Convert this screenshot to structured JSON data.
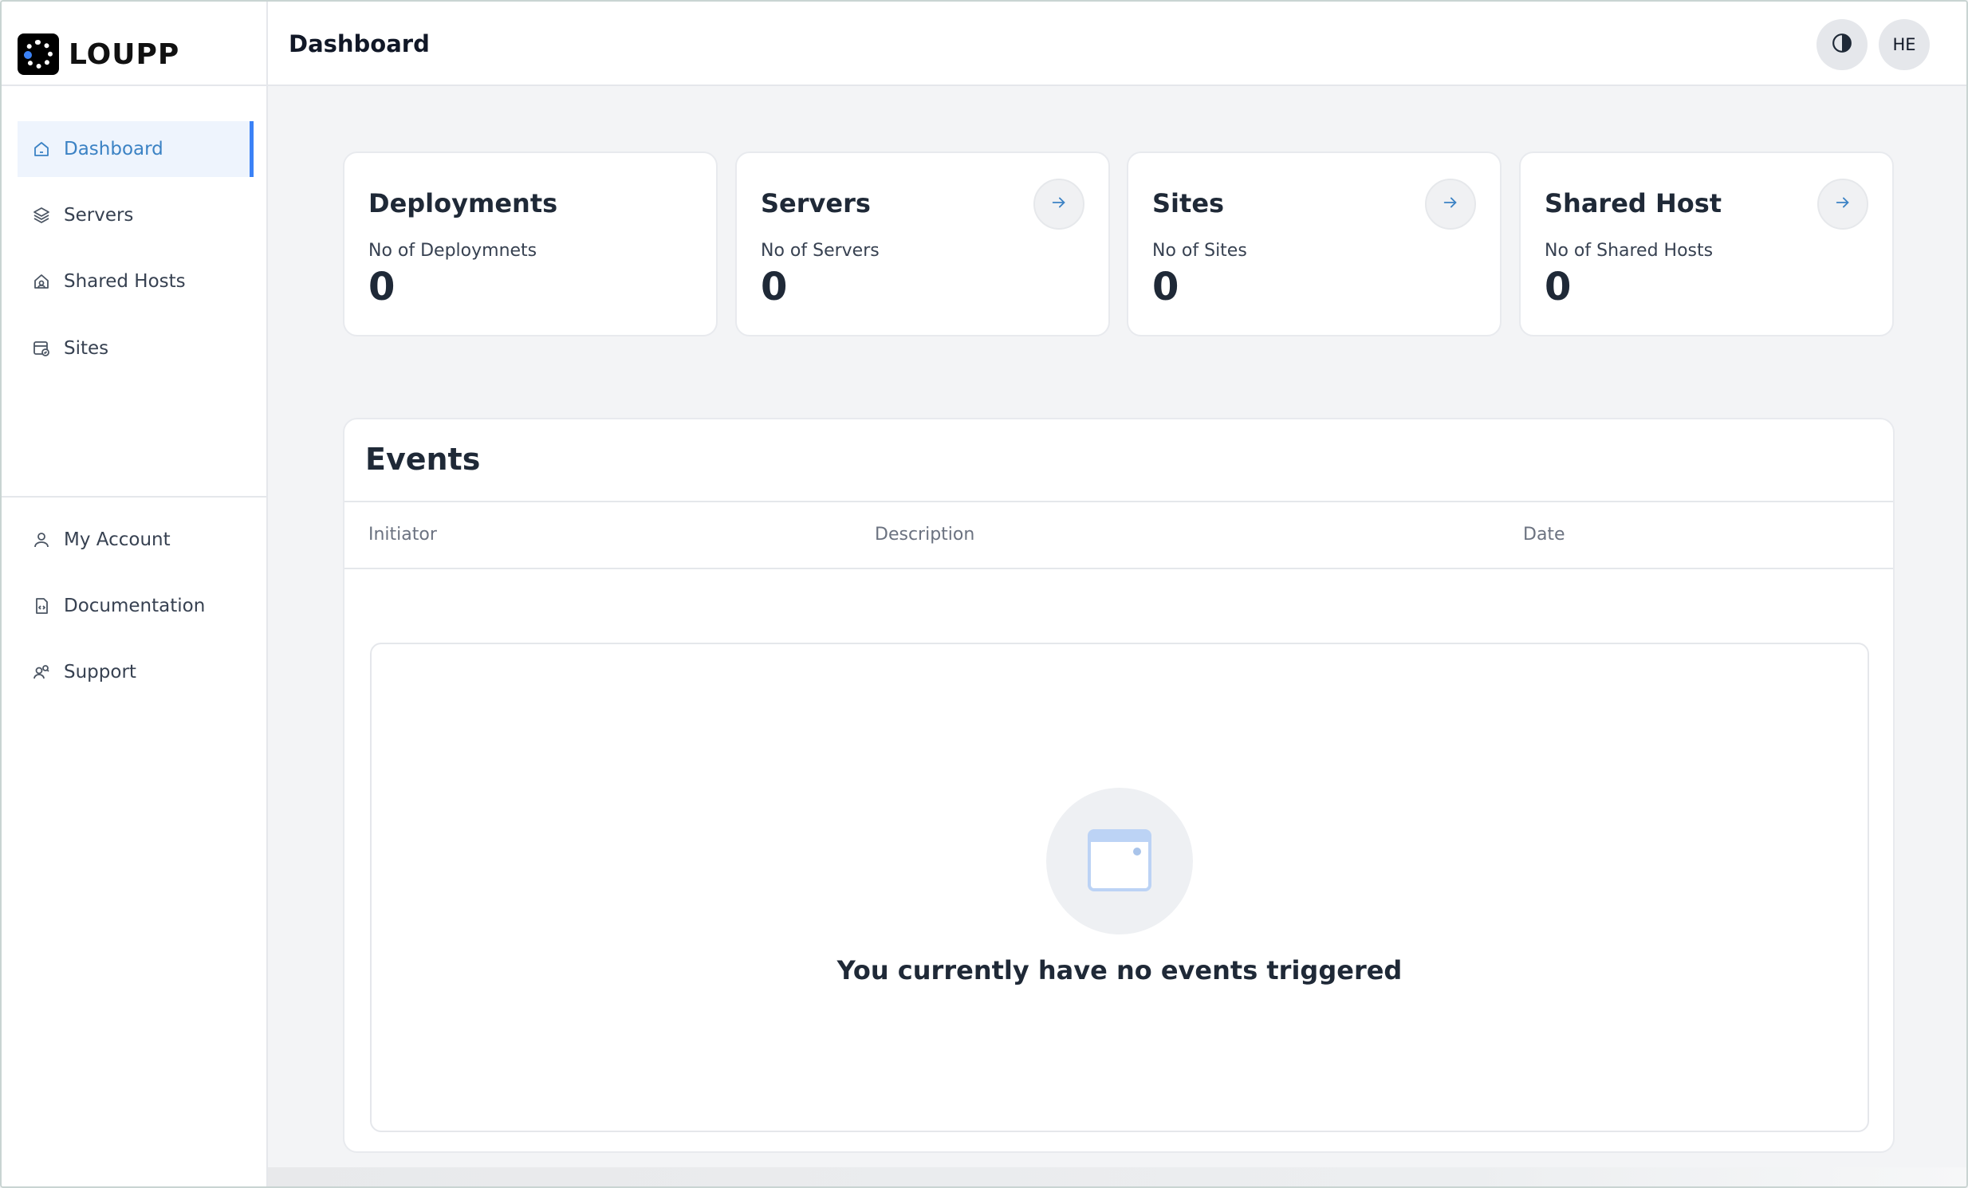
{
  "app": {
    "logo_text": "LOUPP"
  },
  "sidebar": {
    "main_items": [
      {
        "label": "Dashboard",
        "icon": "home-icon",
        "active": true
      },
      {
        "label": "Servers",
        "icon": "layers-icon"
      },
      {
        "label": "Shared Hosts",
        "icon": "shared-hosts-icon"
      },
      {
        "label": "Sites",
        "icon": "sites-icon"
      }
    ],
    "footer_items": [
      {
        "label": "My Account",
        "icon": "user-icon"
      },
      {
        "label": "Documentation",
        "icon": "documentation-icon"
      },
      {
        "label": "Support",
        "icon": "support-icon"
      }
    ]
  },
  "header": {
    "title": "Dashboard",
    "theme_icon": "contrast-icon",
    "avatar_initials": "HE"
  },
  "cards": [
    {
      "title": "Deployments",
      "subtitle": "No of Deploymnets",
      "value": "0",
      "has_arrow": false
    },
    {
      "title": "Servers",
      "subtitle": "No of Servers",
      "value": "0",
      "has_arrow": true
    },
    {
      "title": "Sites",
      "subtitle": "No of Sites",
      "value": "0",
      "has_arrow": true
    },
    {
      "title": "Shared Host",
      "subtitle": "No of Shared Hosts",
      "value": "0",
      "has_arrow": true
    }
  ],
  "events": {
    "title": "Events",
    "columns": [
      "Initiator",
      "Description",
      "Date"
    ],
    "rows": [],
    "empty_message": "You currently have no events triggered",
    "empty_icon": "browser-window-icon"
  },
  "colors": {
    "accent": "#3b82f6",
    "active_bg": "#eef4fd",
    "text": "#1f2937"
  }
}
